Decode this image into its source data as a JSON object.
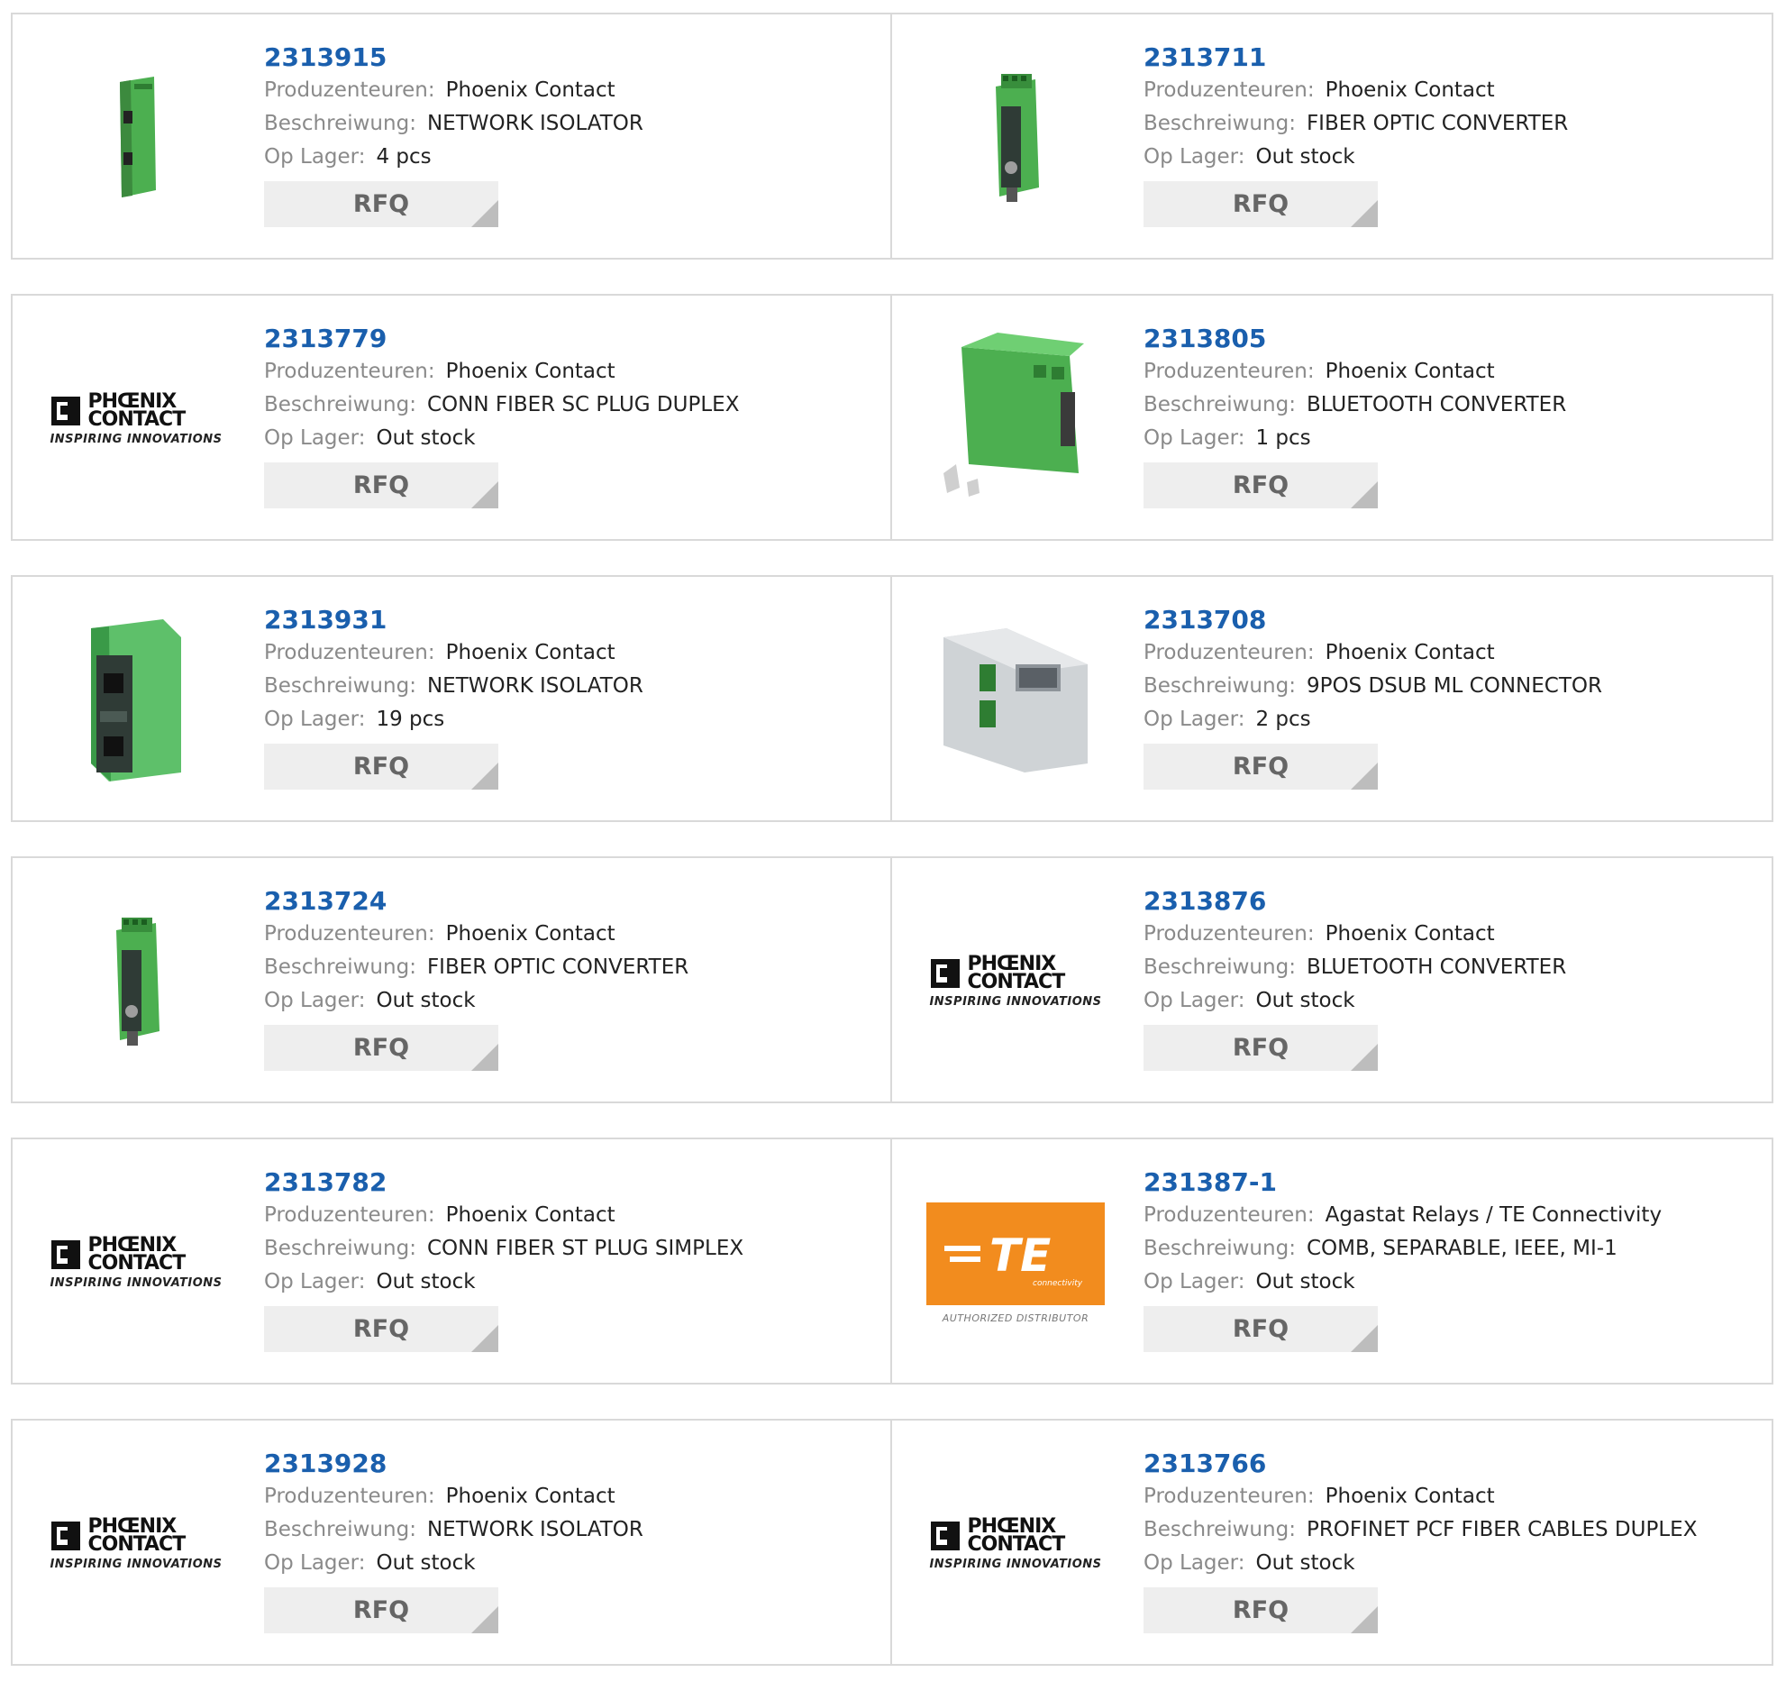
{
  "rfq_label": "RFQ",
  "labels": {
    "manufacturer": "Produzenteuren:",
    "description": "Beschreiwung:",
    "stock": "Op Lager:"
  },
  "phoenix_logo": {
    "line1": "PHŒNIX",
    "line2": "CONTACT",
    "tagline": "INSPIRING INNOVATIONS"
  },
  "te_logo": {
    "mark": "TE",
    "sub": "connectivity",
    "tagline": "AUTHORIZED DISTRIBUTOR"
  },
  "products": [
    {
      "part": "2313915",
      "manufacturer": "Phoenix Contact",
      "description": "NETWORK ISOLATOR",
      "stock": "4 pcs",
      "image": "device-isolator-small"
    },
    {
      "part": "2313711",
      "manufacturer": "Phoenix Contact",
      "description": "FIBER OPTIC CONVERTER",
      "stock": "Out stock",
      "image": "device-fiber-converter"
    },
    {
      "part": "2313779",
      "manufacturer": "Phoenix Contact",
      "description": "CONN FIBER SC PLUG DUPLEX",
      "stock": "Out stock",
      "image": "phoenix-logo"
    },
    {
      "part": "2313805",
      "manufacturer": "Phoenix Contact",
      "description": "BLUETOOTH CONVERTER",
      "stock": "1 pcs",
      "image": "device-bluetooth-converter"
    },
    {
      "part": "2313931",
      "manufacturer": "Phoenix Contact",
      "description": "NETWORK ISOLATOR",
      "stock": "19 pcs",
      "image": "device-isolator-large"
    },
    {
      "part": "2313708",
      "manufacturer": "Phoenix Contact",
      "description": "9POS DSUB ML CONNECTOR",
      "stock": "2 pcs",
      "image": "device-dsub-connector"
    },
    {
      "part": "2313724",
      "manufacturer": "Phoenix Contact",
      "description": "FIBER OPTIC CONVERTER",
      "stock": "Out stock",
      "image": "device-fiber-converter"
    },
    {
      "part": "2313876",
      "manufacturer": "Phoenix Contact",
      "description": "BLUETOOTH CONVERTER",
      "stock": "Out stock",
      "image": "phoenix-logo"
    },
    {
      "part": "2313782",
      "manufacturer": "Phoenix Contact",
      "description": "CONN FIBER ST PLUG SIMPLEX",
      "stock": "Out stock",
      "image": "phoenix-logo"
    },
    {
      "part": "231387-1",
      "manufacturer": "Agastat Relays / TE Connectivity",
      "description": "COMB, SEPARABLE, IEEE, MI-1",
      "stock": "Out stock",
      "image": "te-logo"
    },
    {
      "part": "2313928",
      "manufacturer": "Phoenix Contact",
      "description": "NETWORK ISOLATOR",
      "stock": "Out stock",
      "image": "phoenix-logo"
    },
    {
      "part": "2313766",
      "manufacturer": "Phoenix Contact",
      "description": "PROFINET PCF FIBER CABLES DUPLEX",
      "stock": "Out stock",
      "image": "phoenix-logo"
    }
  ],
  "colors": {
    "part_link": "#1a5fad",
    "label": "#8a8a8a",
    "value": "#222222",
    "rfq_bg": "#eeeeee",
    "rfq_text": "#666666",
    "rfq_corner": "#bdbdbd",
    "border": "#d9d9d9",
    "device_green": "#4caf50",
    "te_orange": "#f28c1e"
  }
}
